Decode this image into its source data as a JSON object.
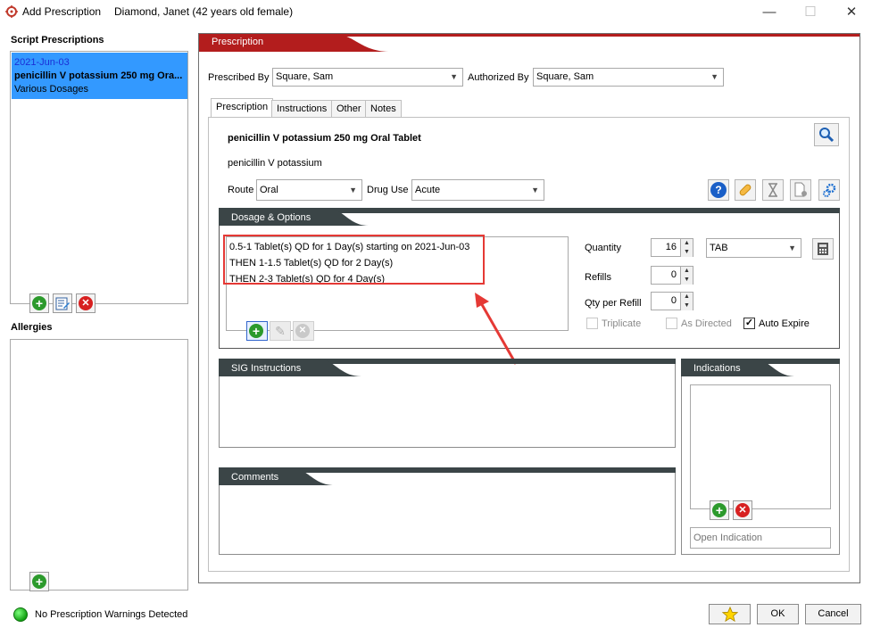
{
  "window": {
    "title": "Add Prescription",
    "patient": "Diamond, Janet (42 years old female)",
    "controls": {
      "minimize": "—",
      "maximize": "☐",
      "close": "✕"
    }
  },
  "left": {
    "script_label": "Script Prescriptions",
    "script_items": [
      {
        "date": "2021-Jun-03",
        "drug": "penicillin V potassium 250 mg Ora...",
        "dosage": "Various Dosages"
      }
    ],
    "allergies_label": "Allergies"
  },
  "prescription": {
    "banner": "Prescription",
    "prescribed_by_label": "Prescribed By",
    "prescribed_by_value": "Square, Sam",
    "authorized_by_label": "Authorized By",
    "authorized_by_value": "Square, Sam",
    "tabs": [
      "Prescription",
      "Instructions",
      "Other",
      "Notes"
    ],
    "drug_title": "penicillin V potassium 250 mg Oral Tablet",
    "drug_generic": "penicillin V potassium",
    "route_label": "Route",
    "route_value": "Oral",
    "drug_use_label": "Drug Use",
    "drug_use_value": "Acute"
  },
  "dosage": {
    "header": "Dosage & Options",
    "lines": [
      "0.5-1 Tablet(s) QD for 1 Day(s)  starting on 2021-Jun-03",
      "THEN 1-1.5 Tablet(s) QD for 2 Day(s)",
      "THEN 2-3 Tablet(s) QD for 4 Day(s)"
    ],
    "quantity_label": "Quantity",
    "quantity_value": "16",
    "unit_value": "TAB",
    "refills_label": "Refills",
    "refills_value": "0",
    "qty_per_refill_label": "Qty per Refill",
    "qty_per_refill_value": "0",
    "triplicate_label": "Triplicate",
    "as_directed_label": "As Directed",
    "auto_expire_label": "Auto Expire",
    "auto_expire_checked": true
  },
  "sig": {
    "header": "SIG Instructions"
  },
  "comments": {
    "header": "Comments"
  },
  "indications": {
    "header": "Indications",
    "placeholder": "Open Indication"
  },
  "footer": {
    "warning_text": "No Prescription Warnings Detected",
    "ok_label": "OK",
    "cancel_label": "Cancel"
  },
  "colors": {
    "banner_red": "#b31d1d",
    "header_dark": "#3b4547",
    "selection_blue": "#3399ff",
    "highlight_box": "#e53935",
    "status_green": "#1fb51f"
  },
  "icons": [
    "app-icon",
    "add-icon",
    "edit-list-icon",
    "remove-icon",
    "search-icon",
    "help-icon",
    "pill-icon",
    "hourglass-icon",
    "document-add-icon",
    "settings-gears-icon",
    "pencil-icon",
    "calculator-icon",
    "star-icon",
    "status-dot-icon"
  ]
}
